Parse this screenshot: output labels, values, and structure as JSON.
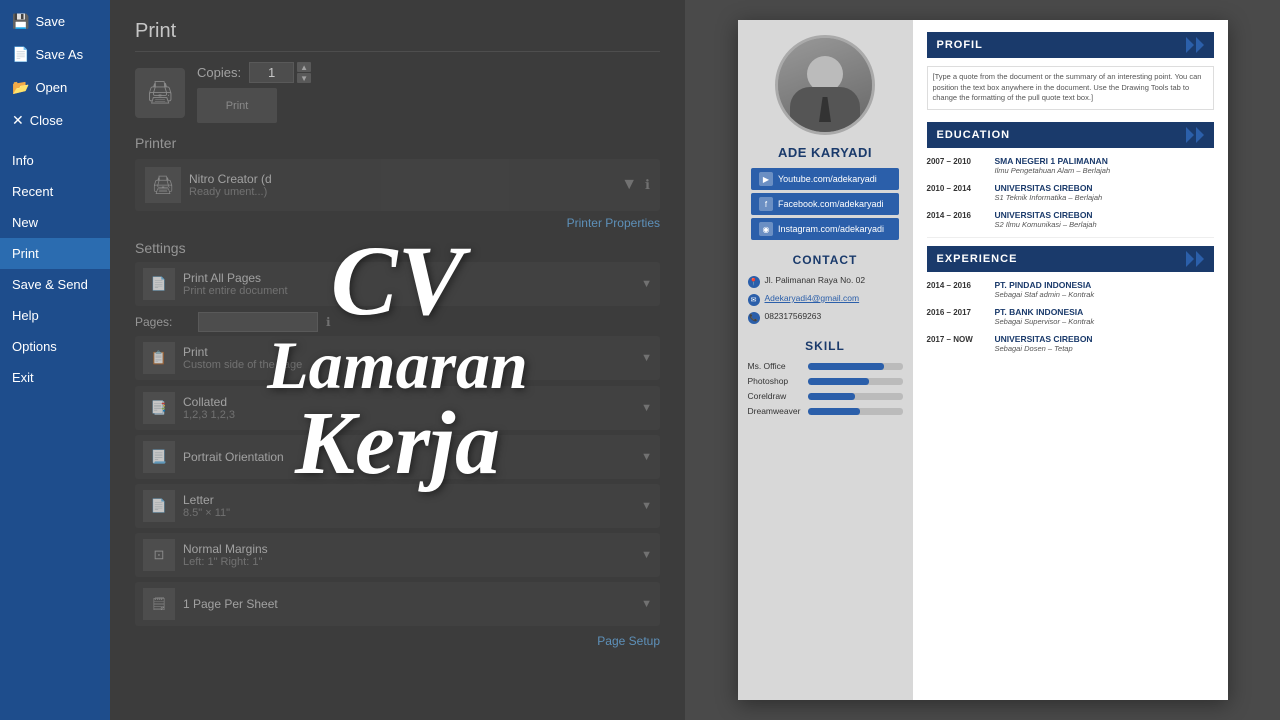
{
  "sidebar": {
    "items": [
      {
        "label": "Save",
        "icon": "💾",
        "active": false
      },
      {
        "label": "Save As",
        "icon": "📄",
        "active": false
      },
      {
        "label": "Open",
        "icon": "📂",
        "active": false
      },
      {
        "label": "Close",
        "icon": "✕",
        "active": false
      },
      {
        "label": "Info",
        "icon": "ℹ",
        "active": false
      },
      {
        "label": "Recent",
        "icon": "🕐",
        "active": false
      },
      {
        "label": "New",
        "icon": "📝",
        "active": false
      },
      {
        "label": "Print",
        "icon": "🖨",
        "active": true
      },
      {
        "label": "Save & Send",
        "icon": "📤",
        "active": false
      },
      {
        "label": "Help",
        "icon": "❓",
        "active": false
      },
      {
        "label": "Options",
        "icon": "⚙",
        "active": false
      },
      {
        "label": "Exit",
        "icon": "🚪",
        "active": false
      }
    ]
  },
  "print_dialog": {
    "title": "Print",
    "copies_label": "Copies:",
    "copies_value": "1",
    "printer_section": "Printer",
    "printer_name": "Nitro Creator (d",
    "printer_sub": "Ready  ument...)",
    "printer_properties": "Printer Properties",
    "settings_section": "Settings",
    "settings": [
      {
        "label": "Print All Pages",
        "sub": "Print entire document"
      },
      {
        "label": "Pages:",
        "sub": "Print"
      },
      {
        "label": "Pages:",
        "sub": "Custom side of the page"
      },
      {
        "label": "Collated",
        "sub": "1,2,3  1,2,3"
      },
      {
        "label": "Portrait Orientation",
        "sub": ""
      },
      {
        "label": "Letter",
        "sub": "8.5\" × 11\""
      },
      {
        "label": "Normal Margins",
        "sub": "Left: 1\"  Right: 1\""
      },
      {
        "label": "1 Page Per Sheet",
        "sub": ""
      }
    ],
    "page_setup": "Page Setup"
  },
  "overlay": {
    "line1": "CV",
    "line2": "Lamaran",
    "line3": "Kerja"
  },
  "cv": {
    "name": "ADE KARYADI",
    "social": [
      {
        "platform": "YouTube",
        "url": "Youtube.com/adekaryadi",
        "icon": "▶"
      },
      {
        "platform": "Facebook",
        "url": "Facebook.com/adekaryadi",
        "icon": "f"
      },
      {
        "platform": "Instagram",
        "url": "Instagram.com/adekaryadi",
        "icon": "◉"
      }
    ],
    "contact_section": "CONTACT",
    "contact": {
      "address": "Jl. Palimanan Raya No. 02",
      "email": "Adekaryadi4@gmail.com",
      "phone": "082317569263"
    },
    "skill_section": "SKILL",
    "skills": [
      {
        "name": "Ms. Office",
        "percent": 80
      },
      {
        "name": "Photoshop",
        "percent": 65
      },
      {
        "name": "Coreldraw",
        "percent": 50
      },
      {
        "name": "Dreamweaver",
        "percent": 55
      }
    ],
    "profil_section": "PROFIL",
    "profil_text": "[Type a quote from the document or the summary of an interesting point. You can position the text box anywhere in the document. Use the Drawing Tools tab to change the formatting of the pull quote text box.]",
    "education_section": "EDUCATION",
    "education": [
      {
        "years": "2007 – 2010",
        "school": "SMA NEGERI 1 PALIMANAN",
        "desc": "Ilmu Pengetahuan Alam – Berlajah"
      },
      {
        "years": "2010 – 2014",
        "school": "UNIVERSITAS CIREBON",
        "desc": "S1 Teknik Informatika – Berlajah"
      },
      {
        "years": "2014 – 2016",
        "school": "UNIVERSITAS CIREBON",
        "desc": "S2 Ilmu Komunikasi – Berlajah"
      }
    ],
    "experience_section": "EXPERIENCE",
    "experience": [
      {
        "years": "2014 – 2016",
        "company": "PT. PINDAD INDONESIA",
        "desc": "Sebagai Staf admin – Kontrak"
      },
      {
        "years": "2016 – 2017",
        "company": "PT. BANK INDONESIA",
        "desc": "Sebagai Supervisor – Kontrak"
      },
      {
        "years": "2017 – NOW",
        "company": "UNIVERSITAS CIREBON",
        "desc": "Sebagai Dosen – Tetap"
      }
    ]
  }
}
